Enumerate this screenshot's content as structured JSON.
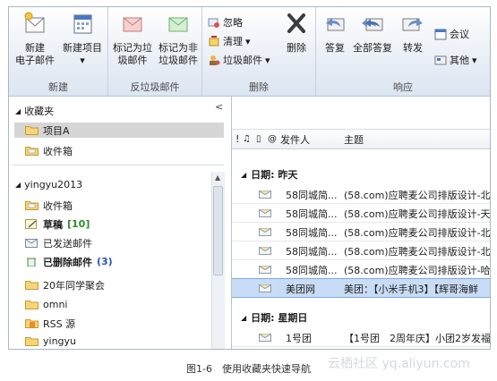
{
  "ribbon": {
    "groups": {
      "new": {
        "label": "新建",
        "new_email": [
          "新建",
          "电子邮件"
        ],
        "new_item": [
          "新建项目",
          ""
        ]
      },
      "junk": {
        "label": "反垃圾邮件",
        "mark_junk": [
          "标记为垃",
          "圾邮件"
        ],
        "mark_not_junk": [
          "标记为非",
          "垃圾邮件"
        ]
      },
      "delete": {
        "label": "删除",
        "ignore": "忽略",
        "cleanup": "清理",
        "junk": "垃圾邮件",
        "delete": "删除"
      },
      "respond": {
        "label": "响应",
        "reply": "答复",
        "reply_all": "全部答复",
        "forward": "转发",
        "meeting": "会议",
        "more": "其他"
      }
    }
  },
  "nav": {
    "favorites": {
      "title": "收藏夹",
      "items": [
        "项目A",
        "收件箱"
      ]
    },
    "account": {
      "title": "yingyu2013",
      "items": [
        {
          "label": "收件箱",
          "count": "",
          "bold": false
        },
        {
          "label": "草稿",
          "count": "[10]",
          "bold": true
        },
        {
          "label": "已发送邮件",
          "count": "",
          "bold": false
        },
        {
          "label": "已删除邮件",
          "count": "(3)",
          "bold": true
        },
        {
          "label": "20年同学聚会",
          "count": "",
          "bold": false
        },
        {
          "label": "omni",
          "count": "",
          "bold": false
        },
        {
          "label": "RSS 源",
          "count": "",
          "bold": false
        },
        {
          "label": "yingyu",
          "count": "",
          "bold": false
        }
      ]
    },
    "collapse_glyph": "<"
  },
  "mail": {
    "columns": {
      "importance": "!",
      "sender": "发件人",
      "subject": "主题"
    },
    "groups": [
      {
        "label": "日期: 昨天",
        "rows": [
          {
            "sender": "58同城简...",
            "subject": "(58.com)应聘麦公司排版设计-北"
          },
          {
            "sender": "58同城简...",
            "subject": "(58.com)应聘麦公司排版设计-天"
          },
          {
            "sender": "58同城简...",
            "subject": "(58.com)应聘麦公司排版设计-北"
          },
          {
            "sender": "58同城简...",
            "subject": "(58.com)应聘麦公司排版设计-北"
          },
          {
            "sender": "58同城简...",
            "subject": "(58.com)应聘麦公司排版设计-哈"
          },
          {
            "sender": "美团网",
            "subject": "美团：【小米手机3】【辉哥海鲜"
          }
        ]
      },
      {
        "label": "日期: 星期日",
        "rows": [
          {
            "sender": "1号团",
            "subject": "【1号团　2周年庆】小团2岁发福"
          }
        ]
      }
    ]
  },
  "caption": "图1-6　使用收藏夹快速导航",
  "watermark": "云栖社区 yq.aliyun.com"
}
